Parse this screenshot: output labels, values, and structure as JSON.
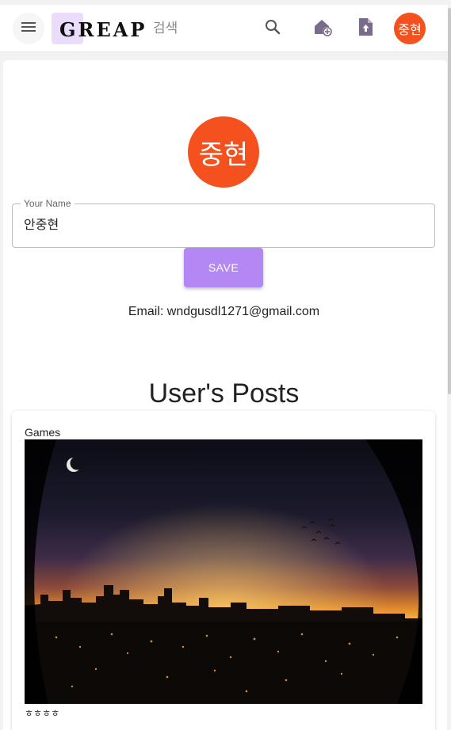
{
  "header": {
    "logo": "GREAP",
    "search_label": "검색",
    "avatar_initials": "중현",
    "icons": {
      "menu": "menu-icon",
      "search": "search-icon",
      "add_home": "home-add-icon",
      "upload": "file-upload-icon"
    }
  },
  "profile": {
    "avatar_initials": "중현",
    "name_field": {
      "label": "Your Name",
      "value": "안중현"
    },
    "save_label": "SAVE",
    "email_text": "Email: wndgusdl1271@gmail.com"
  },
  "posts": {
    "title": "User's Posts",
    "items": [
      {
        "category": "Games",
        "caption": "ㅎㅎㅎㅎ",
        "image": "city-skyline-sunset-photo"
      }
    ]
  },
  "colors": {
    "accent_purple": "#b388f5",
    "logo_bg": "#ecdcfb",
    "avatar_orange": "#f4511e",
    "icon_purple": "#7a6a8c"
  }
}
